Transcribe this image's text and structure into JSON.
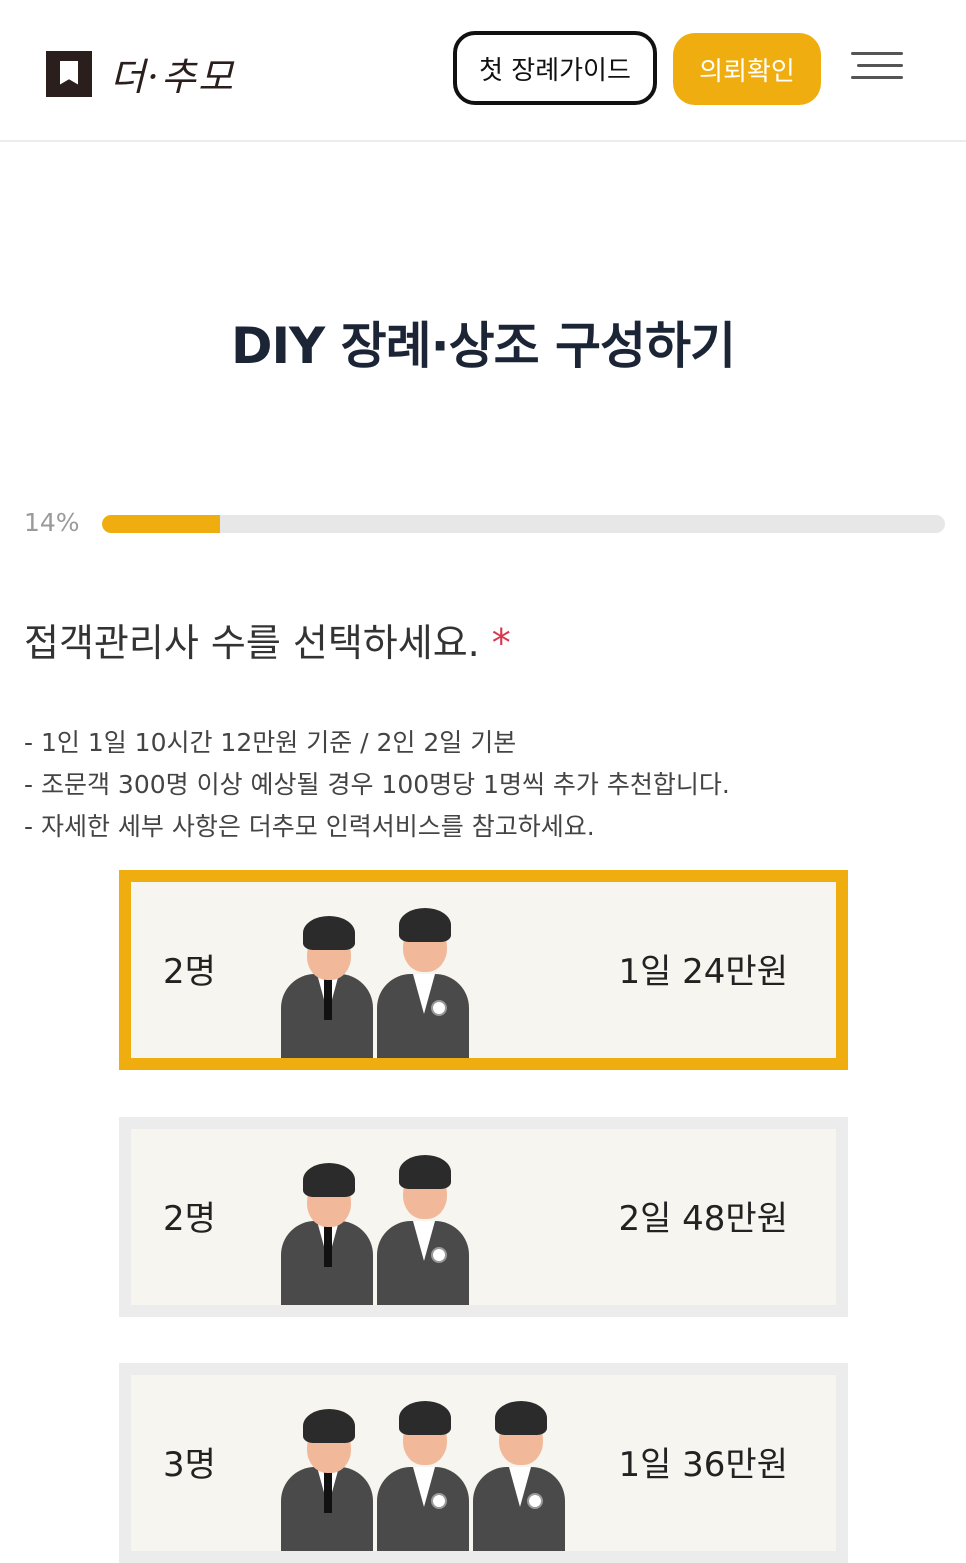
{
  "header": {
    "logo_text": "더·추모",
    "guide_button": "첫 장례가이드",
    "check_button": "의뢰확인"
  },
  "title": "DIY 장례·상조 구성하기",
  "progress": {
    "label": "14%",
    "value": 0.14
  },
  "question": {
    "text": "접객관리사 수를 선택하세요.",
    "required": "*"
  },
  "notes": [
    "- 1인 1일 10시간 12만원 기준 / 2인 2일 기본",
    "- 조문객 300명 이상 예상될 경우 100명당 1명씩 추가 추천합니다.",
    "- 자세한 세부 사항은 더추모 인력서비스를 참고하세요."
  ],
  "options": [
    {
      "count": "2명",
      "price": "1일 24만원",
      "people": 2,
      "selected": true
    },
    {
      "count": "2명",
      "price": "2일 48만원",
      "people": 2,
      "selected": false
    },
    {
      "count": "3명",
      "price": "1일 36만원",
      "people": 3,
      "selected": false
    }
  ],
  "colors": {
    "accent": "#f0ad0f",
    "required": "#d9364f",
    "title": "#1c2535"
  }
}
